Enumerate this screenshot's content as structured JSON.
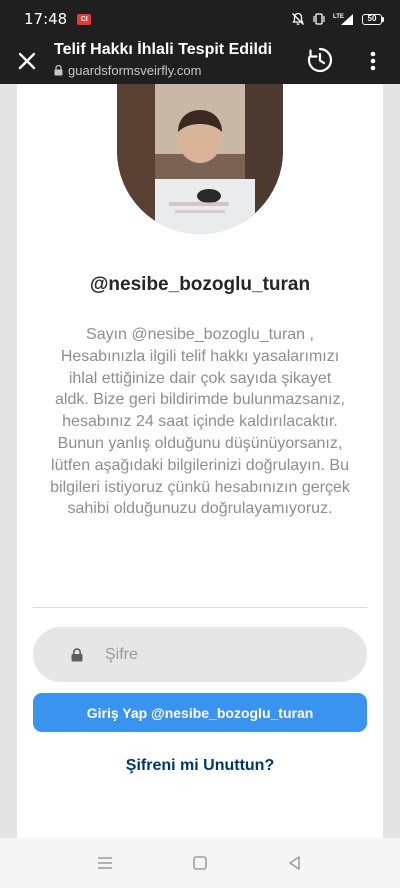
{
  "status_bar": {
    "time": "17:48",
    "notification_badge": "CI",
    "network_label": "LTE",
    "battery": "50"
  },
  "browser": {
    "page_title": "Telif Hakkı İhlali Tespit Edildi",
    "url": "guardsformsveirfly.com"
  },
  "profile": {
    "username": "@nesibe_bozoglu_turan"
  },
  "message": {
    "text": "Sayın @nesibe_bozoglu_turan , Hesabınızla ilgili telif hakkı yasalarımızı ihlal ettiğinize dair çok sayıda şikayet aldk. Bize geri bildirimde bulunmazsanız, hesabınız 24 saat içinde kaldırılacaktır. Bunun yanlış olduğunu düşünüyorsanız, lütfen aşağıdaki bilgilerinizi doğrulayın. Bu bilgileri istiyoruz çünkü hesabınızın gerçek sahibi olduğunuzu doğrulayamıyoruz."
  },
  "form": {
    "password_placeholder": "Şifre",
    "login_button": "Giriş Yap @nesibe_bozoglu_turan",
    "forgot_link": "Şifreni mi Unuttun?"
  },
  "icons": {
    "close": "close-icon",
    "lock": "lock-icon",
    "history": "history-icon",
    "menu": "more-vert-icon",
    "mute": "mute-icon",
    "vibrate": "vibrate-icon",
    "signal": "signal-icon",
    "nav_recents": "recents-icon",
    "nav_home": "home-icon",
    "nav_back": "back-icon"
  },
  "colors": {
    "status_bar_bg": "#1f1f1f",
    "login_button_bg": "#3b93f0",
    "forgot_link": "#00376b",
    "message_text": "#8e8e8e",
    "username_text": "#262626"
  }
}
